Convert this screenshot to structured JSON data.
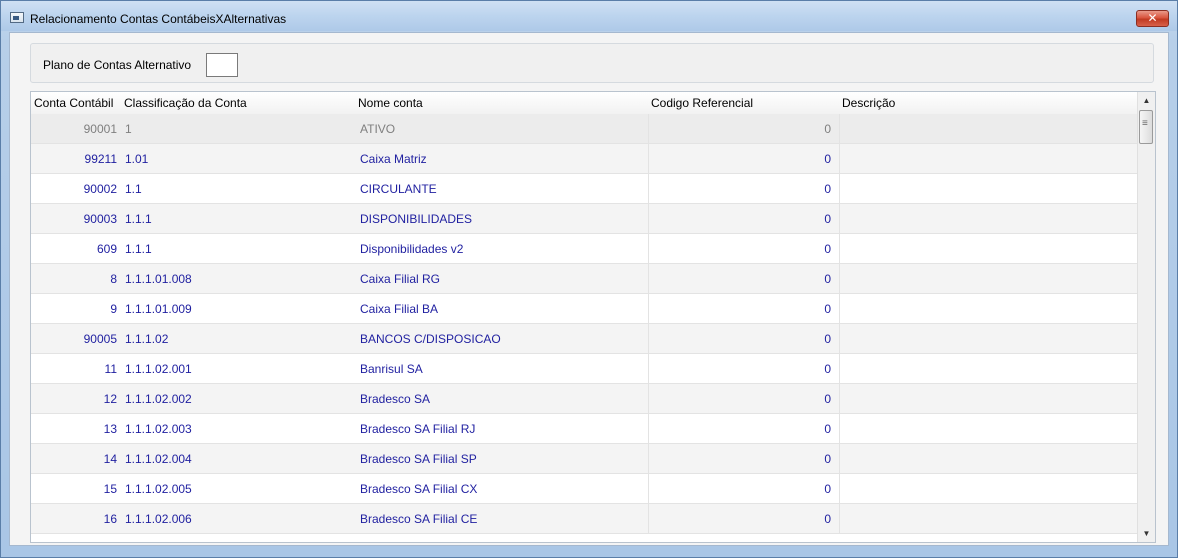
{
  "window": {
    "title": "Relacionamento Contas ContábeisXAlternativas",
    "close_label": "✕"
  },
  "filter": {
    "label": "Plano de Contas Alternativo",
    "value": ""
  },
  "grid": {
    "columns": [
      "Conta Contábil",
      "Classificação da Conta",
      "Nome conta",
      "Codigo Referencial",
      "Descrição"
    ],
    "rows": [
      {
        "conta": "90001",
        "classificacao": "1",
        "nome": "ATIVO",
        "codigo": "0",
        "descricao": ""
      },
      {
        "conta": "99211",
        "classificacao": "1.01",
        "nome": "Caixa Matriz",
        "codigo": "0",
        "descricao": ""
      },
      {
        "conta": "90002",
        "classificacao": "1.1",
        "nome": "CIRCULANTE",
        "codigo": "0",
        "descricao": ""
      },
      {
        "conta": "90003",
        "classificacao": "1.1.1",
        "nome": "DISPONIBILIDADES",
        "codigo": "0",
        "descricao": ""
      },
      {
        "conta": "609",
        "classificacao": "1.1.1",
        "nome": "Disponibilidades v2",
        "codigo": "0",
        "descricao": ""
      },
      {
        "conta": "8",
        "classificacao": "1.1.1.01.008",
        "nome": "Caixa Filial RG",
        "codigo": "0",
        "descricao": ""
      },
      {
        "conta": "9",
        "classificacao": "1.1.1.01.009",
        "nome": "Caixa Filial BA",
        "codigo": "0",
        "descricao": ""
      },
      {
        "conta": "90005",
        "classificacao": "1.1.1.02",
        "nome": "BANCOS C/DISPOSICAO",
        "codigo": "0",
        "descricao": ""
      },
      {
        "conta": "11",
        "classificacao": "1.1.1.02.001",
        "nome": "Banrisul SA",
        "codigo": "0",
        "descricao": ""
      },
      {
        "conta": "12",
        "classificacao": "1.1.1.02.002",
        "nome": "Bradesco SA",
        "codigo": "0",
        "descricao": ""
      },
      {
        "conta": "13",
        "classificacao": "1.1.1.02.003",
        "nome": "Bradesco SA Filial RJ",
        "codigo": "0",
        "descricao": ""
      },
      {
        "conta": "14",
        "classificacao": "1.1.1.02.004",
        "nome": "Bradesco SA Filial SP",
        "codigo": "0",
        "descricao": ""
      },
      {
        "conta": "15",
        "classificacao": "1.1.1.02.005",
        "nome": "Bradesco SA Filial CX",
        "codigo": "0",
        "descricao": ""
      },
      {
        "conta": "16",
        "classificacao": "1.1.1.02.006",
        "nome": "Bradesco SA Filial CE",
        "codigo": "0",
        "descricao": ""
      }
    ]
  },
  "icons": {
    "app": "app-window-icon",
    "scroll_up": "chevron-up-icon",
    "scroll_down": "chevron-down-icon",
    "scroll_thumb": "scroll-thumb-grip-icon"
  }
}
